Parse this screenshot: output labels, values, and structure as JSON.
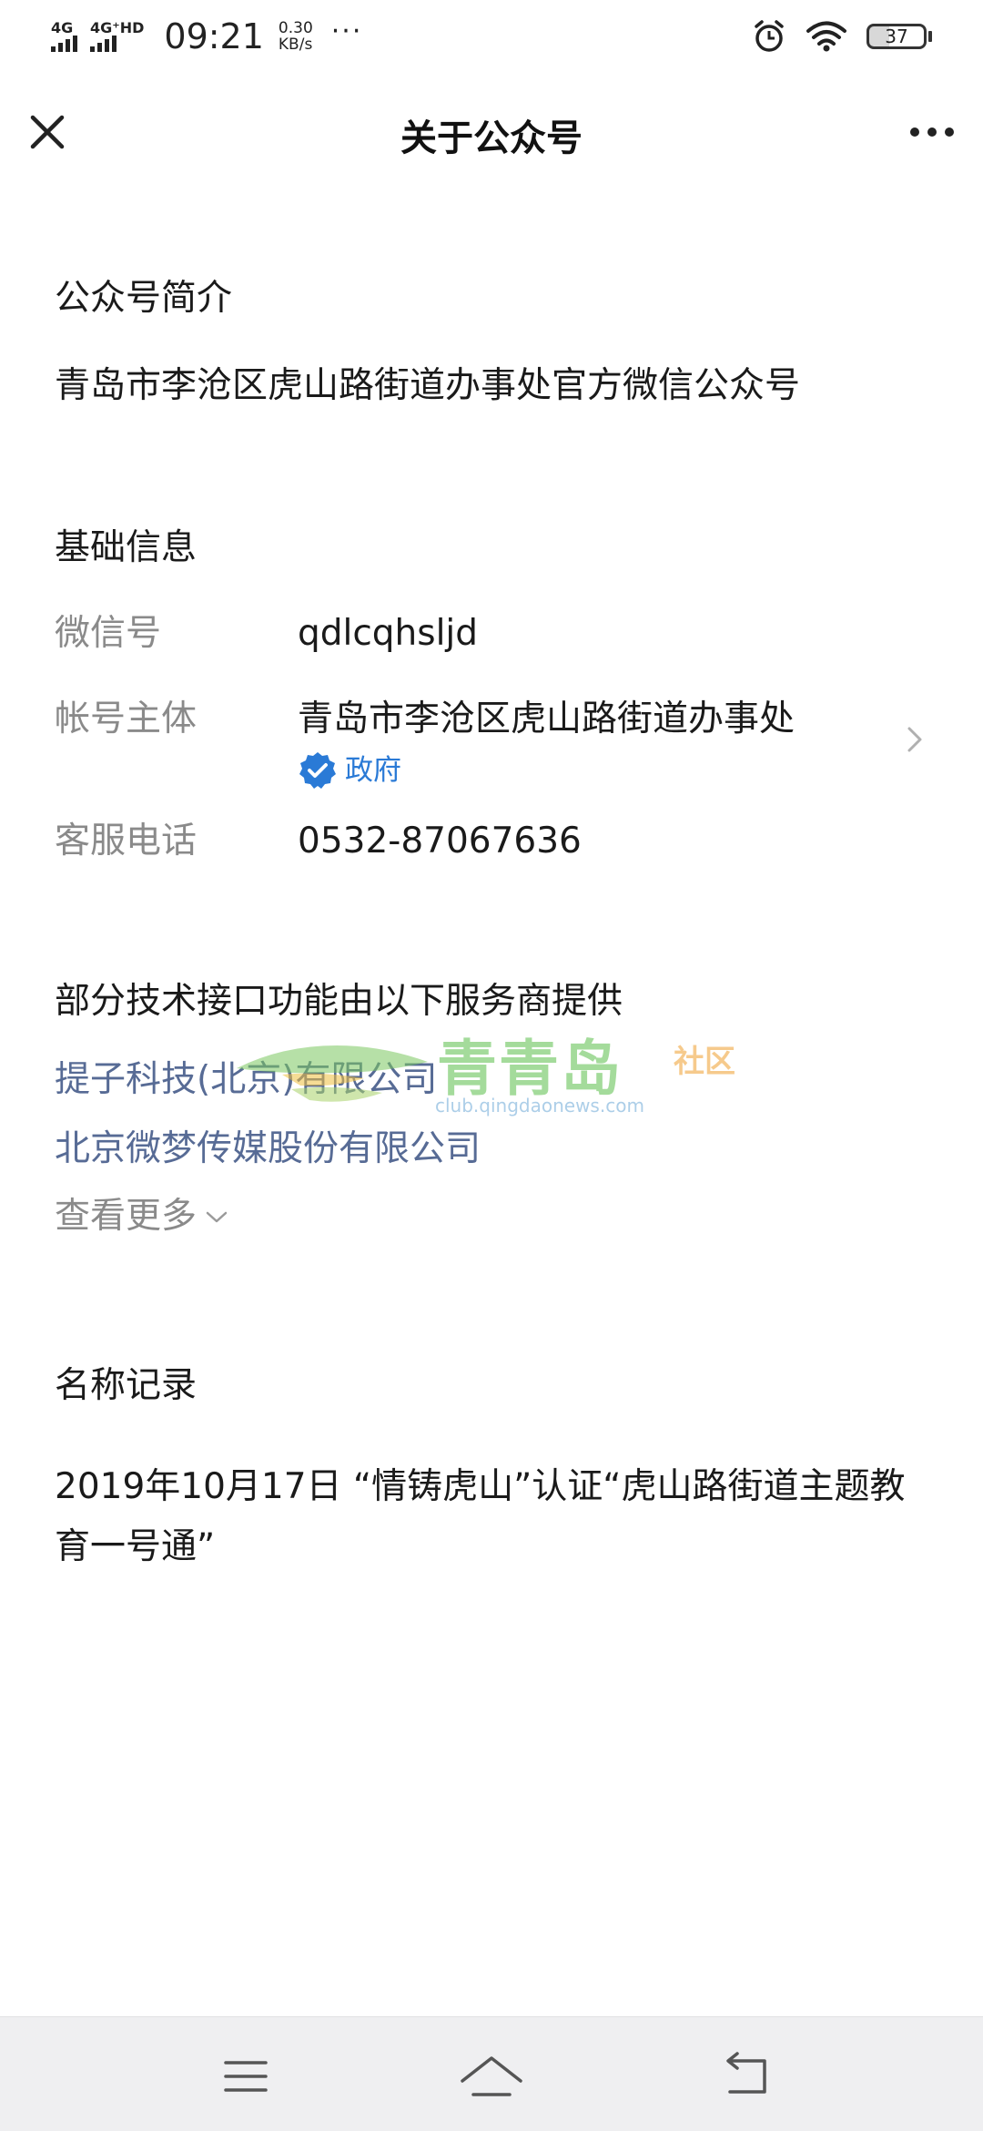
{
  "status_bar": {
    "network1": "4G",
    "network2": "4G⁺HD",
    "time": "09:21",
    "speed_value": "0.30",
    "speed_unit": "KB/s",
    "more": "···",
    "battery": "37"
  },
  "nav": {
    "title": "关于公众号"
  },
  "intro": {
    "title": "公众号简介",
    "text": "青岛市李沧区虎山路街道办事处官方微信公众号"
  },
  "basic_info": {
    "title": "基础信息",
    "wechat_id_label": "微信号",
    "wechat_id_value": "qdlcqhsljd",
    "subject_label": "帐号主体",
    "subject_value": "青岛市李沧区虎山路街道办事处",
    "subject_tag": "政府",
    "phone_label": "客服电话",
    "phone_value": "0532-87067636"
  },
  "providers": {
    "title": "部分技术接口功能由以下服务商提供",
    "items": [
      "提子科技(北京)有限公司",
      "北京微梦传媒股份有限公司"
    ],
    "see_more": "查看更多"
  },
  "name_records": {
    "title": "名称记录",
    "text": "2019年10月17日 “情铸虎山”认证“虎山路街道主题教育一号通”"
  },
  "watermark": {
    "brand": "青青岛",
    "suffix": "社区",
    "url": "club.qingdaonews.com"
  },
  "colors": {
    "link": "#576b95",
    "verified": "#2a7ad6",
    "label": "#8a8a8a"
  }
}
